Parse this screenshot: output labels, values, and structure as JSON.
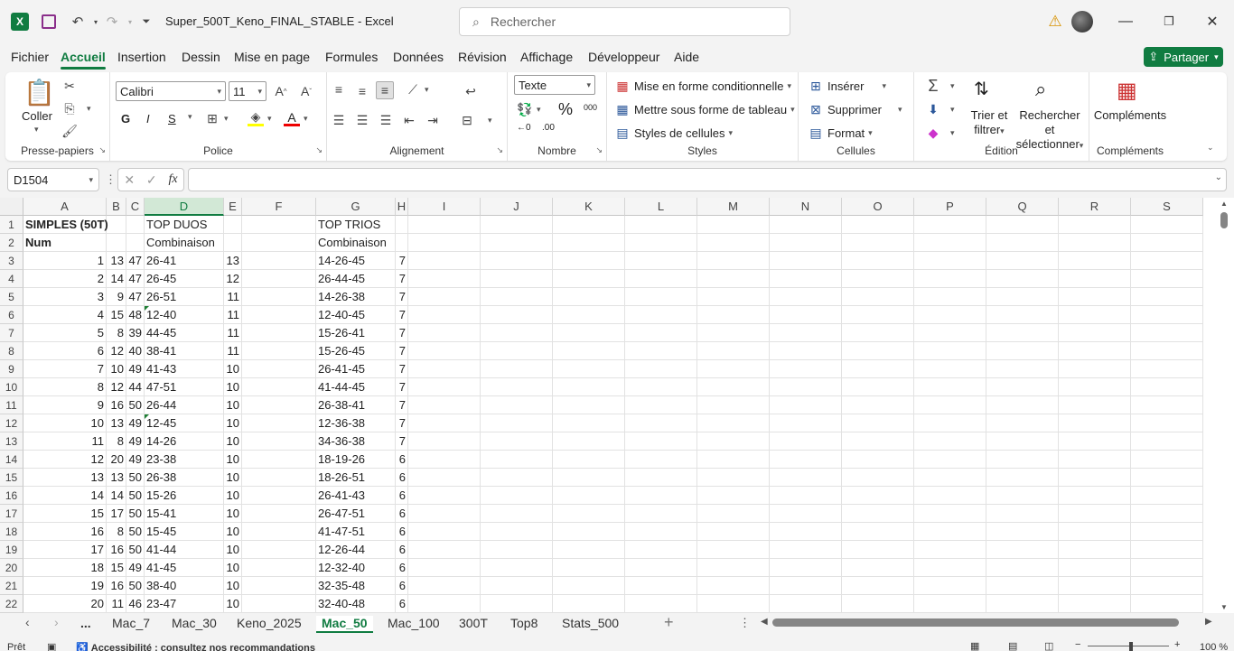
{
  "window": {
    "title": "Super_500T_Keno_FINAL_STABLE  -  Excel",
    "search_placeholder": "Rechercher"
  },
  "menu": {
    "tabs": [
      "Fichier",
      "Accueil",
      "Insertion",
      "Dessin",
      "Mise en page",
      "Formules",
      "Données",
      "Révision",
      "Affichage",
      "Développeur",
      "Aide"
    ],
    "share": "Partager"
  },
  "ribbon": {
    "clipboard": {
      "paste": "Coller",
      "label": "Presse-papiers"
    },
    "font": {
      "name": "Calibri",
      "size": "11",
      "bold": "G",
      "italic": "I",
      "underline": "S",
      "label": "Police"
    },
    "alignment": {
      "label": "Alignement"
    },
    "number": {
      "format": "Texte",
      "label": "Nombre"
    },
    "styles": {
      "conditional": "Mise en forme conditionnelle",
      "table": "Mettre sous forme de tableau",
      "cell_styles": "Styles de cellules",
      "label": "Styles"
    },
    "cells": {
      "insert": "Insérer",
      "delete": "Supprimer",
      "format": "Format",
      "label": "Cellules"
    },
    "editing": {
      "sort_line1": "Trier et",
      "sort_line2": "filtrer",
      "find_line1": "Rechercher et",
      "find_line2": "sélectionner",
      "label": "Édition"
    },
    "addins": {
      "button": "Compléments",
      "label": "Compléments"
    }
  },
  "formula_bar": {
    "name_box": "D1504",
    "fx": "fx",
    "formula": ""
  },
  "sheet": {
    "columns": [
      "A",
      "B",
      "C",
      "D",
      "E",
      "F",
      "G",
      "H",
      "I",
      "J",
      "K",
      "L",
      "M",
      "N",
      "O",
      "P",
      "Q",
      "R",
      "S"
    ],
    "selected_column": "D",
    "rows": [
      {
        "n": "1",
        "A": "SIMPLES (50T)",
        "B": "",
        "C": "",
        "D": "TOP DUOS",
        "E": "",
        "G": "TOP TRIOS",
        "H": ""
      },
      {
        "n": "2",
        "A": "Num",
        "B": "",
        "C": "",
        "D": "Combinaison",
        "E": "",
        "G": "Combinaison",
        "H": ""
      },
      {
        "n": "3",
        "A": "1",
        "B": "13",
        "C": "47",
        "D": "26-41",
        "E": "13",
        "G": "14-26-45",
        "H": "7"
      },
      {
        "n": "4",
        "A": "2",
        "B": "14",
        "C": "47",
        "D": "26-45",
        "E": "12",
        "G": "26-44-45",
        "H": "7"
      },
      {
        "n": "5",
        "A": "3",
        "B": "9",
        "C": "47",
        "D": "26-51",
        "E": "11",
        "G": "14-26-38",
        "H": "7"
      },
      {
        "n": "6",
        "A": "4",
        "B": "15",
        "C": "48",
        "D": "12-40",
        "E": "11",
        "G": "12-40-45",
        "H": "7"
      },
      {
        "n": "7",
        "A": "5",
        "B": "8",
        "C": "39",
        "D": "44-45",
        "E": "11",
        "G": "15-26-41",
        "H": "7"
      },
      {
        "n": "8",
        "A": "6",
        "B": "12",
        "C": "40",
        "D": "38-41",
        "E": "11",
        "G": "15-26-45",
        "H": "7"
      },
      {
        "n": "9",
        "A": "7",
        "B": "10",
        "C": "49",
        "D": "41-43",
        "E": "10",
        "G": "26-41-45",
        "H": "7"
      },
      {
        "n": "10",
        "A": "8",
        "B": "12",
        "C": "44",
        "D": "47-51",
        "E": "10",
        "G": "41-44-45",
        "H": "7"
      },
      {
        "n": "11",
        "A": "9",
        "B": "16",
        "C": "50",
        "D": "26-44",
        "E": "10",
        "G": "26-38-41",
        "H": "7"
      },
      {
        "n": "12",
        "A": "10",
        "B": "13",
        "C": "49",
        "D": "12-45",
        "E": "10",
        "G": "12-36-38",
        "H": "7"
      },
      {
        "n": "13",
        "A": "11",
        "B": "8",
        "C": "49",
        "D": "14-26",
        "E": "10",
        "G": "34-36-38",
        "H": "7"
      },
      {
        "n": "14",
        "A": "12",
        "B": "20",
        "C": "49",
        "D": "23-38",
        "E": "10",
        "G": "18-19-26",
        "H": "6"
      },
      {
        "n": "15",
        "A": "13",
        "B": "13",
        "C": "50",
        "D": "26-38",
        "E": "10",
        "G": "18-26-51",
        "H": "6"
      },
      {
        "n": "16",
        "A": "14",
        "B": "14",
        "C": "50",
        "D": "15-26",
        "E": "10",
        "G": "26-41-43",
        "H": "6"
      },
      {
        "n": "17",
        "A": "15",
        "B": "17",
        "C": "50",
        "D": "15-41",
        "E": "10",
        "G": "26-47-51",
        "H": "6"
      },
      {
        "n": "18",
        "A": "16",
        "B": "8",
        "C": "50",
        "D": "15-45",
        "E": "10",
        "G": "41-47-51",
        "H": "6"
      },
      {
        "n": "19",
        "A": "17",
        "B": "16",
        "C": "50",
        "D": "41-44",
        "E": "10",
        "G": "12-26-44",
        "H": "6"
      },
      {
        "n": "20",
        "A": "18",
        "B": "15",
        "C": "49",
        "D": "41-45",
        "E": "10",
        "G": "12-32-40",
        "H": "6"
      },
      {
        "n": "21",
        "A": "19",
        "B": "16",
        "C": "50",
        "D": "38-40",
        "E": "10",
        "G": "32-35-48",
        "H": "6"
      },
      {
        "n": "22",
        "A": "20",
        "B": "11",
        "C": "46",
        "D": "23-47",
        "E": "10",
        "G": "32-40-48",
        "H": "6"
      }
    ]
  },
  "sheet_tabs": {
    "more": "...",
    "tabs": [
      "Mac_7",
      "Mac_30",
      "Keno_2025",
      "Mac_50",
      "Mac_100",
      "300T",
      "Top8",
      "Stats_500"
    ],
    "active": "Mac_50",
    "add": "+"
  },
  "status": {
    "ready": "Prêt",
    "accessibility": "Accessibilité : consultez nos recommandations",
    "zoom": "100 %"
  },
  "colors": {
    "accent": "#107c41"
  }
}
